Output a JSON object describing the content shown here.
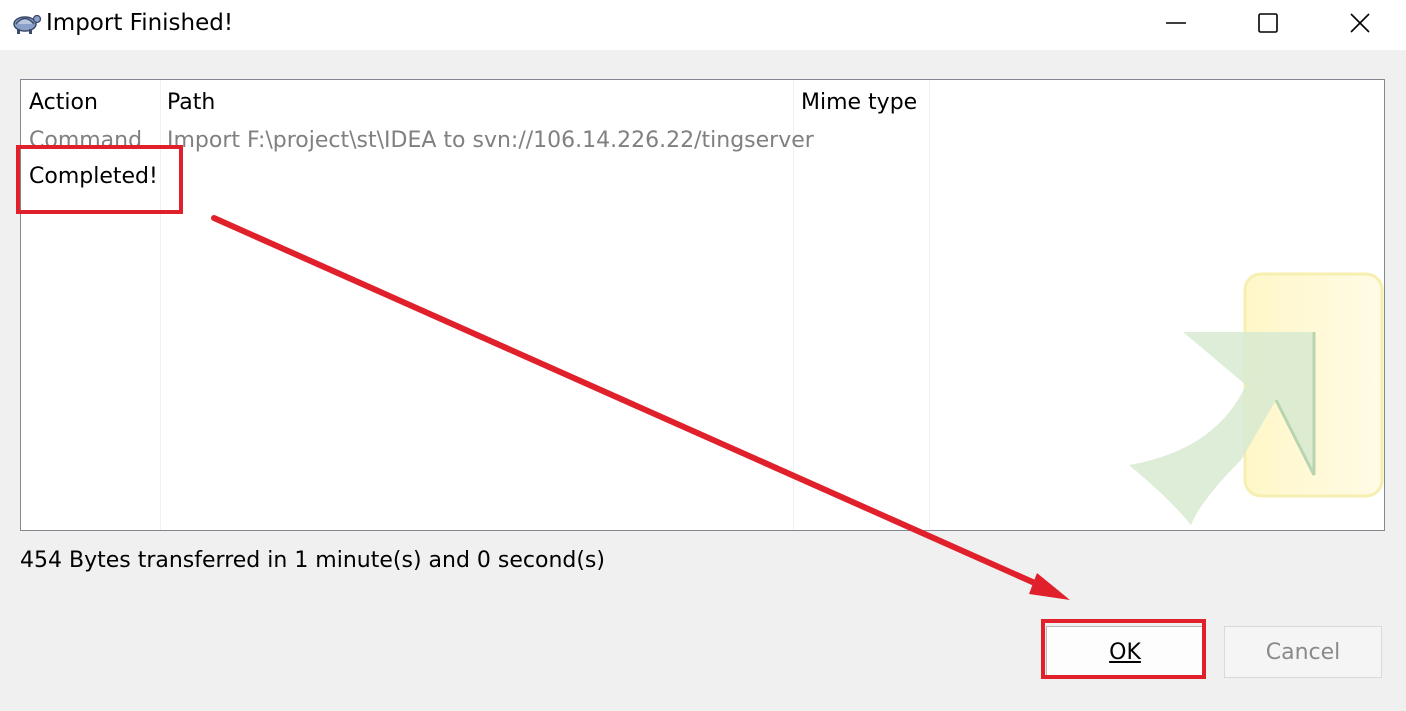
{
  "window": {
    "title": "Import Finished!",
    "app_icon": "tortoise-svn-icon"
  },
  "controls": {
    "minimize_icon": "minimize-icon",
    "maximize_icon": "maximize-icon",
    "close_icon": "close-icon"
  },
  "list": {
    "columns": [
      "Action",
      "Path",
      "Mime type"
    ],
    "rows": [
      {
        "action": "Command",
        "path": "Import F:\\project\\st\\IDEA to svn://106.14.226.22/tingserver",
        "mime": ""
      },
      {
        "action": "Completed!",
        "path": "",
        "mime": ""
      }
    ]
  },
  "status": "454 Bytes transferred in 1 minute(s) and 0 second(s)",
  "buttons": {
    "ok": "OK",
    "cancel": "Cancel"
  },
  "annotation": {
    "highlight_color": "#e0212b"
  }
}
